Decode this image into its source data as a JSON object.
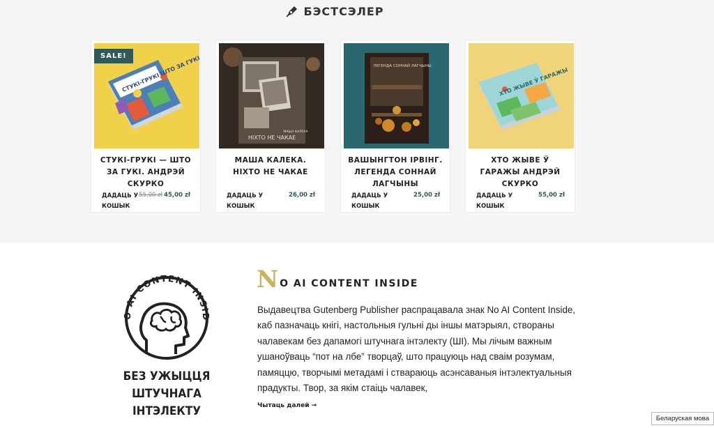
{
  "bestseller": {
    "title": "БЭСТСЭЛЕР"
  },
  "products": [
    {
      "title": "СТУКІ-ГРУКІ — ШТО ЗА ГУКІ. АНДРЭЙ СКУРКО",
      "sale": "SALE!",
      "add_to_cart": "ДАДАЦЬ У КОШЫК",
      "old_price": "55,00 zł",
      "price": "45,00 zł",
      "cover_text": "СТУКІ-ГРУКІ ШТО ЗА ГУКІ"
    },
    {
      "title": "МАША КАЛЕКА. НІХТО НЕ ЧАКАЕ",
      "add_to_cart": "ДАДАЦЬ У КОШЫК",
      "price": "26,00 zł",
      "cover_text": "НІХТО НЕ ЧАКАЕ",
      "cover_author": "МАША КАЛЕКА"
    },
    {
      "title": "ВАШЫНГТОН ІРВІНГ. ЛЕГЕНДА СОННАЙ ЛАГЧЫНЫ",
      "add_to_cart": "ДАДАЦЬ У КОШЫК",
      "price": "25,00 zł",
      "cover_text": "ЛЕГЕНДА СОННАЙ ЛАГЧЫНЫ"
    },
    {
      "title": "ХТО ЖЫВЕ Ў ГАРАЖЫ АНДРЭЙ СКУРКО",
      "add_to_cart": "ДАДАЦЬ У КОШЫК",
      "price": "55,00 zł",
      "cover_text": "ХТО ЖЫВЕ Ў ГАРАЖЫ"
    }
  ],
  "noai": {
    "ring_text": "NO AI CONTENT INSIDE",
    "caption_line1": "БЕЗ УЖЫЦЦЯ",
    "caption_line2": "ШТУЧНАГА ІНТЭЛЕКТУ",
    "heading_cap": "N",
    "heading_rest": "O AI CONTENT INSIDE",
    "text": "Выдавецтва Gutenberg Publisher распрацавала знак No AI Content Inside, каб пазначаць кнігі, настольныя гульні ды іншы матэрыял, створаны чалавекам без дапамогі штучнага інтэлекту (ШІ). Мы лічым важным ушаноўваць “пот на лбе” творцаў, што працуюць над сваім розумам, памяццю, творчымі метадамі і ствараюць асэнсаваныя інтэлектуальныя прадукты. Твор, за якім стаіць чалавек,",
    "read_more": "Чытаць далей →"
  },
  "language": {
    "label": "Беларуская мова"
  },
  "colors": {
    "accent": "#2f5a58",
    "gold": "#c9b35e"
  }
}
